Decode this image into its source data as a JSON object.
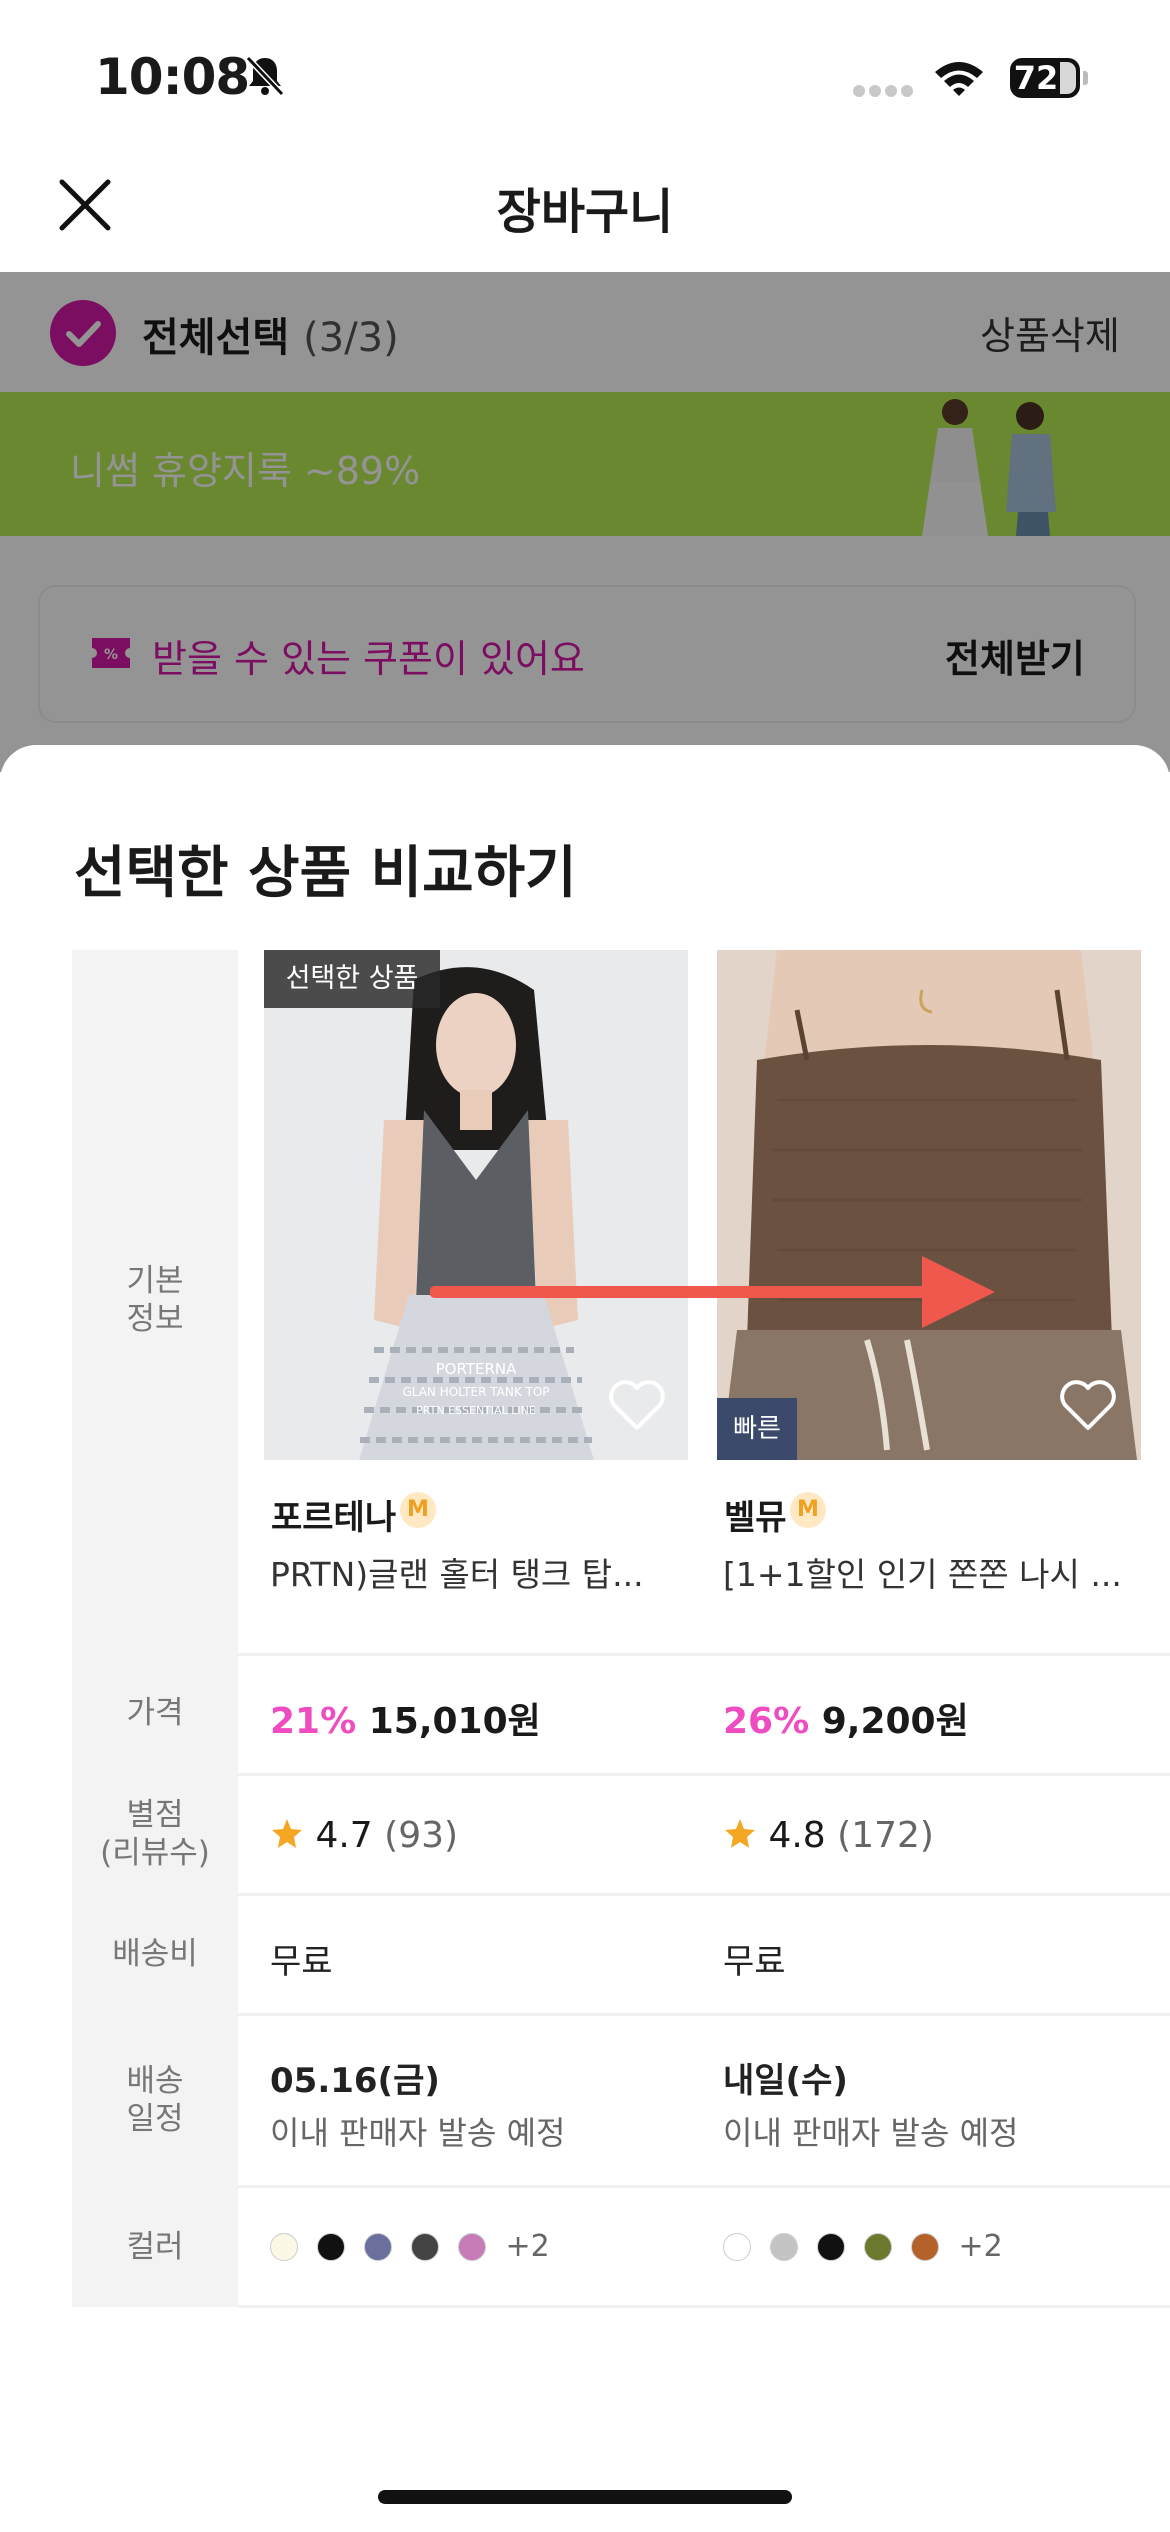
{
  "status_bar": {
    "time": "10:08",
    "battery": "72"
  },
  "header": {
    "title": "장바구니"
  },
  "cart": {
    "select_all_label": "전체선택",
    "select_all_count": "(3/3)",
    "delete_label": "상품삭제",
    "banner_text": "니썸 휴양지룩 ~89%",
    "coupon_text": "받을 수 있는 쿠폰이 있어요",
    "coupon_all_label": "전체받기"
  },
  "sheet": {
    "title": "선택한 상품 비교하기",
    "row_labels": {
      "basic_line1": "기본",
      "basic_line2": "정보",
      "price": "가격",
      "rating_line1": "별점",
      "rating_line2": "(리뷰수)",
      "shipping_fee": "배송비",
      "delivery_line1": "배송",
      "delivery_line2": "일정",
      "color": "컬러"
    },
    "products": [
      {
        "tag": "선택한 상품",
        "brand": "포르테나",
        "badge": "M",
        "name": "PRTN)글랜 홀터 탱크 탑...",
        "image_caption_1": "PORTERNA",
        "image_caption_2": "GLAN HOLTER TANK TOP",
        "image_caption_3": "PRTN ESSENTIAL LINE",
        "discount": "21%",
        "price": "15,010원",
        "rating": "4.7",
        "reviews": "(93)",
        "shipping_fee": "무료",
        "delivery_date": "05.16(금)",
        "delivery_note": "이내 판매자 발송 예정",
        "swatches": [
          "#fbf8e6",
          "#111111",
          "#6b6f9e",
          "#444444",
          "#c77bb7"
        ],
        "more_colors": "+2"
      },
      {
        "tag": "빠른",
        "brand": "벨뮤",
        "badge": "M",
        "name": "[1+1할인 인기 쫀쫀 나시 ...",
        "discount": "26%",
        "price": "9,200원",
        "rating": "4.8",
        "reviews": "(172)",
        "shipping_fee": "무료",
        "delivery_date": "내일(수)",
        "delivery_note": "이내 판매자 발송 예정",
        "swatches": [
          "#ffffff",
          "#c4c4c4",
          "#111111",
          "#6b7a2e",
          "#b5612a"
        ],
        "more_colors": "+2"
      }
    ]
  },
  "colors": {
    "accent": "#d619a8",
    "discount": "#ee4cc0",
    "star": "#f5a623",
    "banner": "#b7ea53",
    "arrow": "#f0584e"
  }
}
